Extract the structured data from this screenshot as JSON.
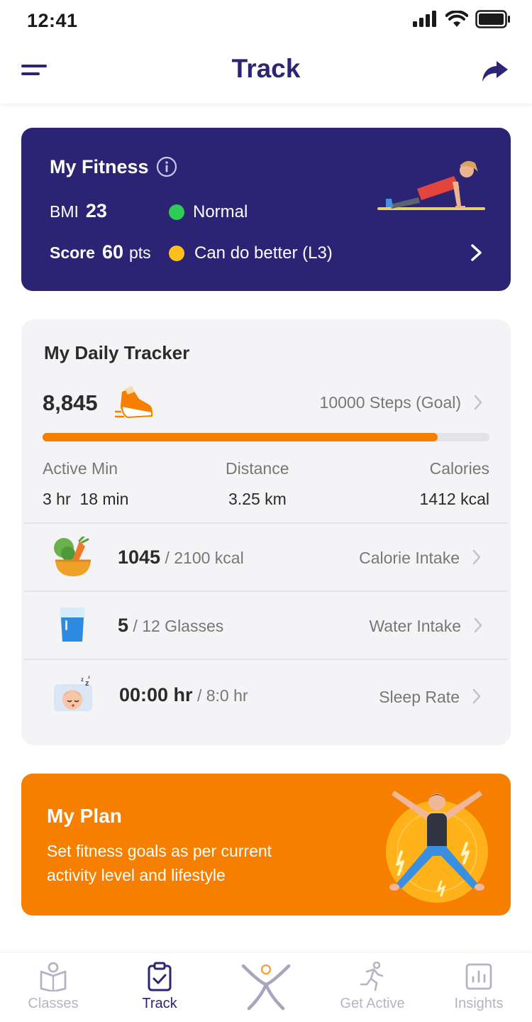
{
  "status_bar": {
    "time": "12:41"
  },
  "header": {
    "title": "Track"
  },
  "fitness": {
    "title": "My Fitness",
    "bmi_label": "BMI",
    "bmi_value": "23",
    "bmi_status": "Normal",
    "score_label": "Score",
    "score_value": "60",
    "score_unit": "pts",
    "score_status": "Can do better (L3)",
    "colors": {
      "card": "#2b2474",
      "normal": "#2ecc55",
      "warning": "#ffbf1a"
    }
  },
  "tracker": {
    "title": "My Daily Tracker",
    "steps": "8,845",
    "steps_goal": "10000 Steps (Goal)",
    "steps_progress": 0.8845,
    "stats": [
      {
        "label": "Active Min",
        "value": "3 hr  18 min"
      },
      {
        "label": "Distance",
        "value": "3.25 km"
      },
      {
        "label": "Calories",
        "value": "1412 kcal"
      }
    ],
    "rows": [
      {
        "icon": "salad-bowl-icon",
        "value": "1045",
        "total": "/ 2100 kcal",
        "label": "Calorie Intake"
      },
      {
        "icon": "water-glass-icon",
        "value": "5",
        "total": "/ 12 Glasses",
        "label": "Water Intake"
      },
      {
        "icon": "sleeping-face-icon",
        "value": "00:00 hr",
        "total": "/ 8:0 hr",
        "label": "Sleep Rate"
      }
    ]
  },
  "plan": {
    "title": "My Plan",
    "line1": "Set fitness goals as per current",
    "line2": "activity level and lifestyle",
    "color": "#f77f00"
  },
  "nav": {
    "items": [
      {
        "label": "Classes",
        "icon": "book-icon",
        "active": false
      },
      {
        "label": "Track",
        "icon": "clipboard-check-icon",
        "active": true
      },
      {
        "label": "",
        "icon": "star-person-icon",
        "active": false
      },
      {
        "label": "Get Active",
        "icon": "runner-icon",
        "active": false
      },
      {
        "label": "Insights",
        "icon": "bar-chart-icon",
        "active": false
      }
    ]
  }
}
